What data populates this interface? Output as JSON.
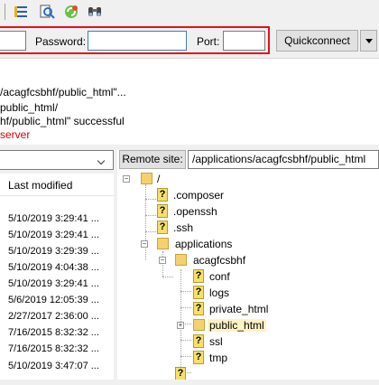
{
  "quickconnect": {
    "password_label": "Password:",
    "port_label": "Port:",
    "button_label": "Quickconnect"
  },
  "log": [
    {
      "text": "/acagfcsbhf/public_html\"...",
      "color": "#000000"
    },
    {
      "text": "public_html/",
      "color": "#000000"
    },
    {
      "text": "hf/public_html\" successful",
      "color": "#000000"
    },
    {
      "text": " server",
      "color": "#d40000"
    }
  ],
  "local": {
    "column_last_modified": "Last modified",
    "rows": [
      "5/10/2019 3:29:41 ...",
      "5/10/2019 3:29:41 ...",
      "5/10/2019 3:29:39 ...",
      "5/10/2019 4:04:38 ...",
      "5/10/2019 3:29:41 ...",
      "5/6/2019 12:05:39 ...",
      "2/27/2017 2:36:00 ...",
      "7/16/2015 8:32:32 ...",
      "7/16/2015 8:32:32 ...",
      "5/10/2019 3:47:07 ..."
    ]
  },
  "remote": {
    "site_label": "Remote site:",
    "path": "/applications/acagfcsbhf/public_html",
    "tree": {
      "root": "/",
      "composer": ".composer",
      "openssh": ".openssh",
      "ssh": ".ssh",
      "applications": "applications",
      "acagfcsbhf": "acagfcsbhf",
      "conf": "conf",
      "logs": "logs",
      "private_html": "private_html",
      "public_html": "public_html",
      "ssl": "ssl",
      "tmp": "tmp"
    }
  }
}
